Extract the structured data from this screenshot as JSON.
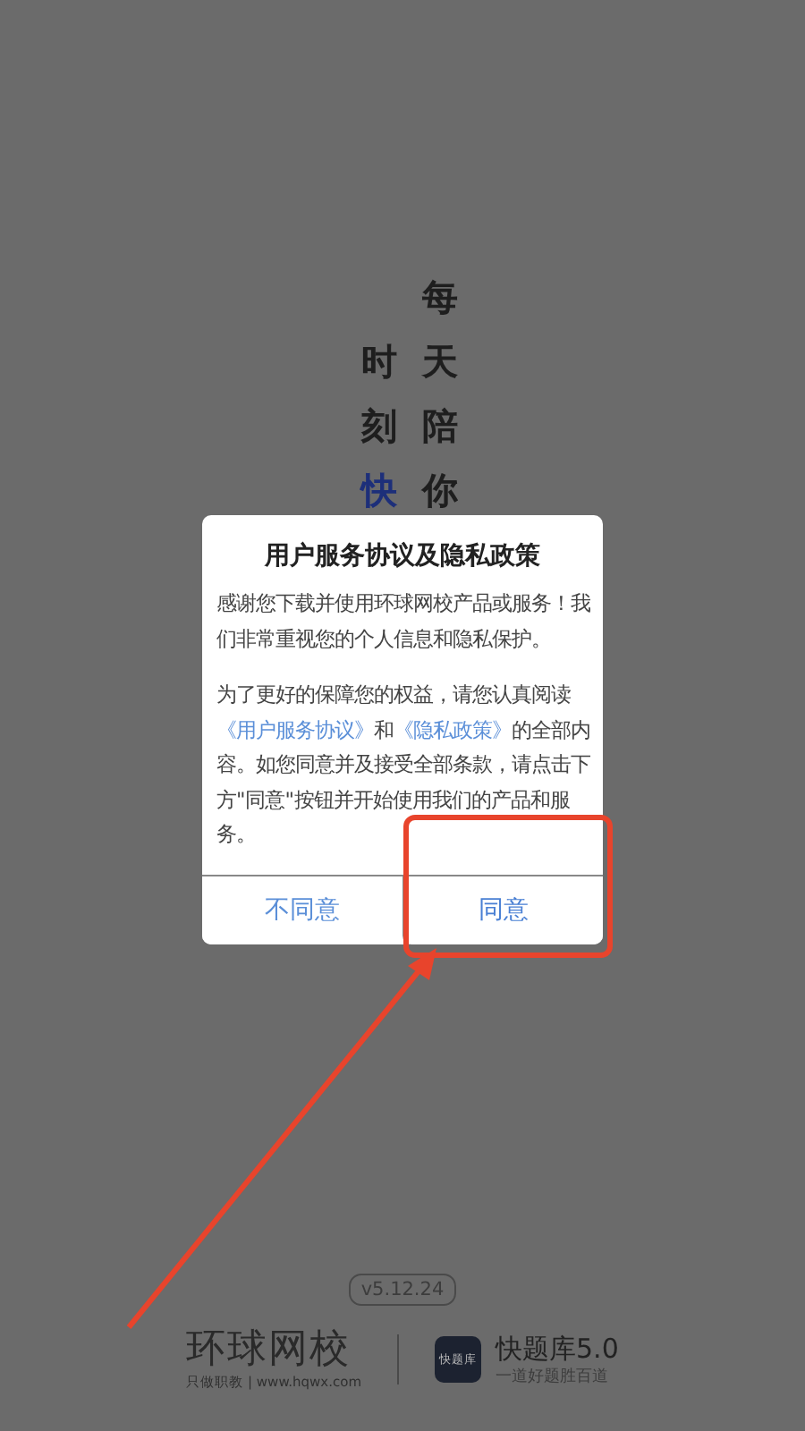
{
  "splash": {
    "slogan_columns": [
      {
        "segments": [
          {
            "text": "时刻",
            "accent": false
          },
          {
            "text": "快",
            "accent": true
          }
        ]
      },
      {
        "segments": [
          {
            "text": "每天陪你",
            "accent": false
          }
        ]
      }
    ],
    "version": "v5.12.24",
    "brand": {
      "name": "环球网校",
      "tagline": "只做职教 | www.hqwx.com"
    },
    "app": {
      "icon_text": "快题库",
      "name": "快题库5.0",
      "tagline": "一道好题胜百道"
    }
  },
  "dialog": {
    "title": "用户服务协议及隐私政策",
    "paragraphs": [
      [
        {
          "text": "感谢您下载并使用环球网校产品或服务！我们非常重视您的个人信息和隐私保护。",
          "link": false
        }
      ],
      [
        {
          "text": "为了更好的保障您的权益，请您认真阅读",
          "link": false
        },
        {
          "text": "《用户服务协议》",
          "link": true
        },
        {
          "text": "和",
          "link": false
        },
        {
          "text": "《隐私政策》",
          "link": true
        },
        {
          "text": "的全部内容。如您同意并及接受全部条款，请点击下方\"同意\"按钮并开始使用我们的产品和服务。",
          "link": false
        }
      ]
    ],
    "buttons": [
      {
        "label": "不同意",
        "highlighted": false
      },
      {
        "label": "同意",
        "highlighted": true
      }
    ]
  }
}
